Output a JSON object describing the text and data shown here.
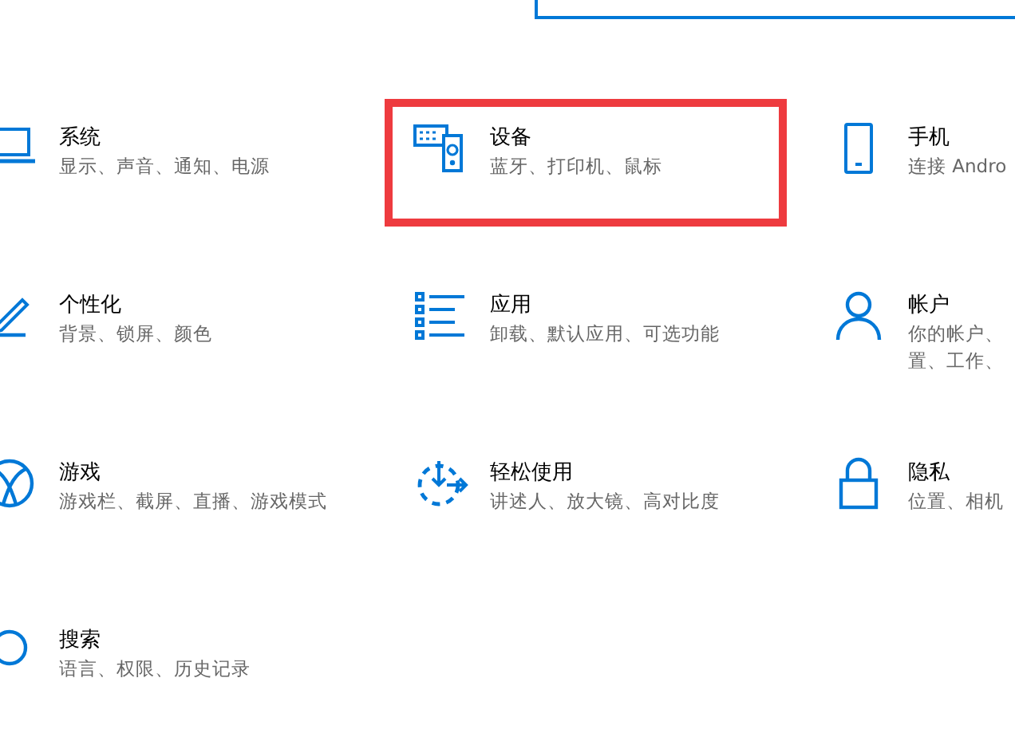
{
  "categories": [
    {
      "kind": "system",
      "title": "系统",
      "description": [
        "显示、声音、通知、电源"
      ],
      "highlighted": false
    },
    {
      "kind": "devices",
      "title": "设备",
      "description": [
        "蓝牙、打印机、鼠标"
      ],
      "highlighted": true
    },
    {
      "kind": "phone",
      "title": "手机",
      "description": [
        "连接 Andro"
      ],
      "highlighted": false
    },
    {
      "kind": "personalization",
      "title": "个性化",
      "description": [
        "背景、锁屏、颜色"
      ],
      "highlighted": false
    },
    {
      "kind": "apps",
      "title": "应用",
      "description": [
        "卸载、默认应用、可选功能"
      ],
      "highlighted": false
    },
    {
      "kind": "accounts",
      "title": "帐户",
      "description": [
        "你的帐户、",
        "置、工作、"
      ],
      "highlighted": false
    },
    {
      "kind": "gaming",
      "title": "游戏",
      "description": [
        "游戏栏、截屏、直播、游戏模式"
      ],
      "highlighted": false
    },
    {
      "kind": "ease",
      "title": "轻松使用",
      "description": [
        "讲述人、放大镜、高对比度"
      ],
      "highlighted": false
    },
    {
      "kind": "privacy",
      "title": "隐私",
      "description": [
        "位置、相机"
      ],
      "highlighted": false
    },
    {
      "kind": "search",
      "title": "搜索",
      "description": [
        "语言、权限、历史记录"
      ],
      "highlighted": false
    }
  ]
}
